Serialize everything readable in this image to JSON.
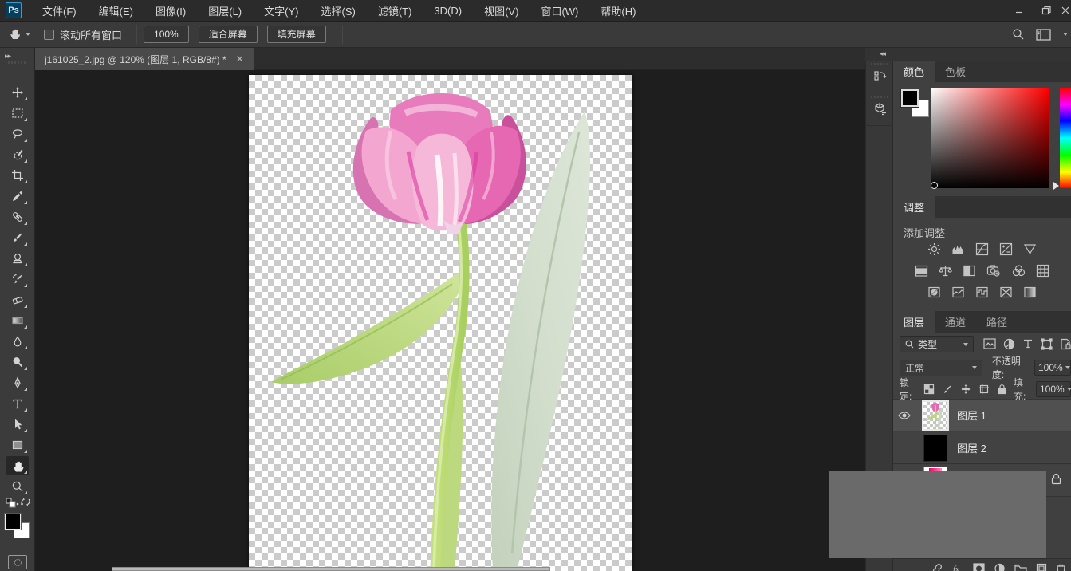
{
  "app": {
    "name": "Ps",
    "window_controls": {
      "minimize": "minimize",
      "restore": "restore",
      "close": "close"
    }
  },
  "menu_bar": {
    "items": [
      "文件(F)",
      "编辑(E)",
      "图像(I)",
      "图层(L)",
      "文字(Y)",
      "选择(S)",
      "滤镜(T)",
      "3D(D)",
      "视图(V)",
      "窗口(W)",
      "帮助(H)"
    ]
  },
  "options_bar": {
    "active_tool": "hand-tool",
    "scroll_all_windows_label": "滚动所有窗口",
    "scroll_all_windows_checked": false,
    "zoom_100_label": "100%",
    "fit_screen_label": "适合屏幕",
    "fill_screen_label": "填充屏幕"
  },
  "document": {
    "tab_title": "j161025_2.jpg @ 120% (图层 1, RGB/8#) *",
    "zoom_level": "120%",
    "active_layer": "图层 1",
    "color_mode": "RGB/8#",
    "canvas_content": "pink tulip flower with green stem and leaves on transparent checkerboard"
  },
  "toolbar": {
    "selected_tool": "hand",
    "foreground_color": "#000000",
    "background_color": "#ffffff",
    "tools": [
      "move",
      "rectangular-marquee",
      "lasso",
      "quick-selection",
      "crop",
      "eyedropper",
      "spot-healing-brush",
      "brush",
      "clone-stamp",
      "history-brush",
      "eraser",
      "gradient",
      "blur",
      "dodge",
      "pen",
      "type",
      "path-selection",
      "rectangle",
      "hand",
      "zoom",
      "edit-toolbar"
    ]
  },
  "right_dock": {
    "collapsed_panels": [
      "history",
      "3d"
    ]
  },
  "panels": {
    "color": {
      "tabs": [
        "颜色",
        "色板"
      ],
      "active_tab": "颜色",
      "foreground": "#000000",
      "background": "#ffffff",
      "hue": "red"
    },
    "adjustments": {
      "tab": "调整",
      "add_label": "添加调整",
      "icons": [
        "brightness-contrast",
        "levels",
        "curves",
        "exposure",
        "vibrance",
        "hue-saturation",
        "color-balance",
        "black-white",
        "photo-filter",
        "channel-mixer",
        "color-lookup",
        "invert",
        "posterize",
        "threshold",
        "selective-color",
        "gradient-map"
      ]
    },
    "layers": {
      "tabs": [
        "图层",
        "通道",
        "路径"
      ],
      "active_tab": "图层",
      "filter_value": "类型",
      "blend_mode": "正常",
      "opacity_label": "不透明度:",
      "opacity_value": "100%",
      "lock_label": "锁定:",
      "fill_label": "填充:",
      "fill_value": "100%",
      "items": [
        {
          "name": "图层 1",
          "visible": true,
          "selected": true,
          "thumbnail": "transparent-tulip"
        },
        {
          "name": "图层 2",
          "visible": false,
          "selected": false,
          "thumbnail": "black"
        },
        {
          "name": "",
          "visible": true,
          "locked": true,
          "thumbnail": "white-pink-image"
        }
      ]
    }
  },
  "overlay_box": {
    "color": "#6a6a6a"
  }
}
